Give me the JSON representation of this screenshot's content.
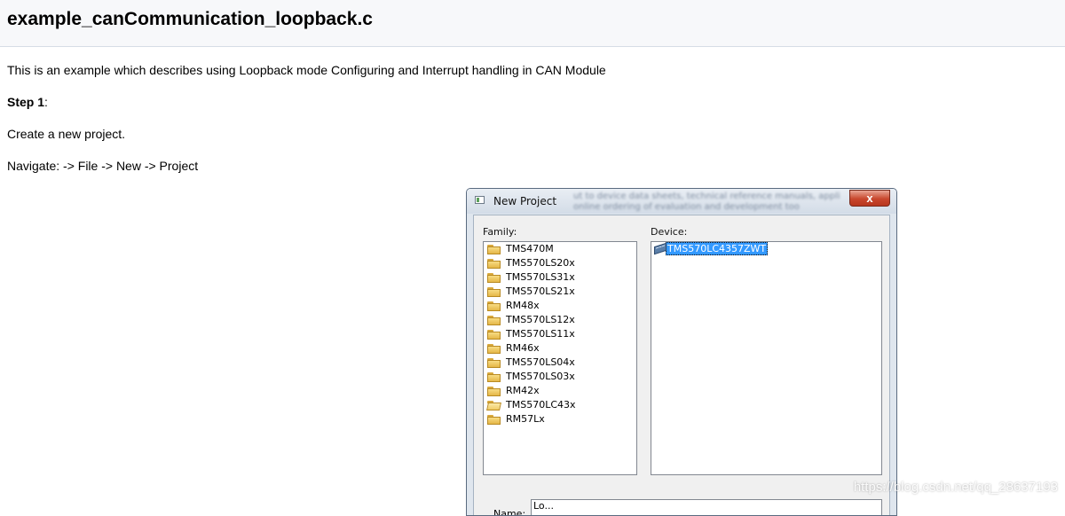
{
  "doc": {
    "title": "example_canCommunication_loopback.c",
    "intro": "This is an example which describes using Loopback mode Configuring and Interrupt handling in CAN Module",
    "step_label": "Step 1",
    "step_colon": ":",
    "create": "Create a new project.",
    "navigate": "Navigate: -> File -> New -> Project"
  },
  "dialog": {
    "title": "New Project",
    "blurred_line1": "ut to device data sheets, technical reference manuals, appli",
    "blurred_line2": "online ordering of evaluation and development too",
    "close_glyph": "x",
    "family_label": "Family:",
    "device_label": "Device:",
    "family_items": [
      {
        "label": "TMS470M",
        "icon": "folder-icon"
      },
      {
        "label": "TMS570LS20x",
        "icon": "folder-icon"
      },
      {
        "label": "TMS570LS31x",
        "icon": "folder-icon"
      },
      {
        "label": "TMS570LS21x",
        "icon": "folder-icon"
      },
      {
        "label": "RM48x",
        "icon": "folder-icon"
      },
      {
        "label": "TMS570LS12x",
        "icon": "folder-icon"
      },
      {
        "label": "TMS570LS11x",
        "icon": "folder-icon"
      },
      {
        "label": "RM46x",
        "icon": "folder-icon"
      },
      {
        "label": "TMS570LS04x",
        "icon": "folder-icon"
      },
      {
        "label": "TMS570LS03x",
        "icon": "folder-icon"
      },
      {
        "label": "RM42x",
        "icon": "folder-icon"
      },
      {
        "label": "TMS570LC43x",
        "icon": "open-folder-icon"
      },
      {
        "label": "RM57Lx",
        "icon": "folder-icon"
      }
    ],
    "device_items": [
      {
        "label": "TMS570LC4357ZWT",
        "icon": "chip-icon",
        "selected": true
      }
    ],
    "name_label": "Name:",
    "name_value": "Lo..."
  },
  "watermark": "https://blog.csdn.net/qq_28637193",
  "colors": {
    "selection": "#3399ff",
    "close_button": "#c8472d",
    "header_bg": "#f7f8fa"
  }
}
